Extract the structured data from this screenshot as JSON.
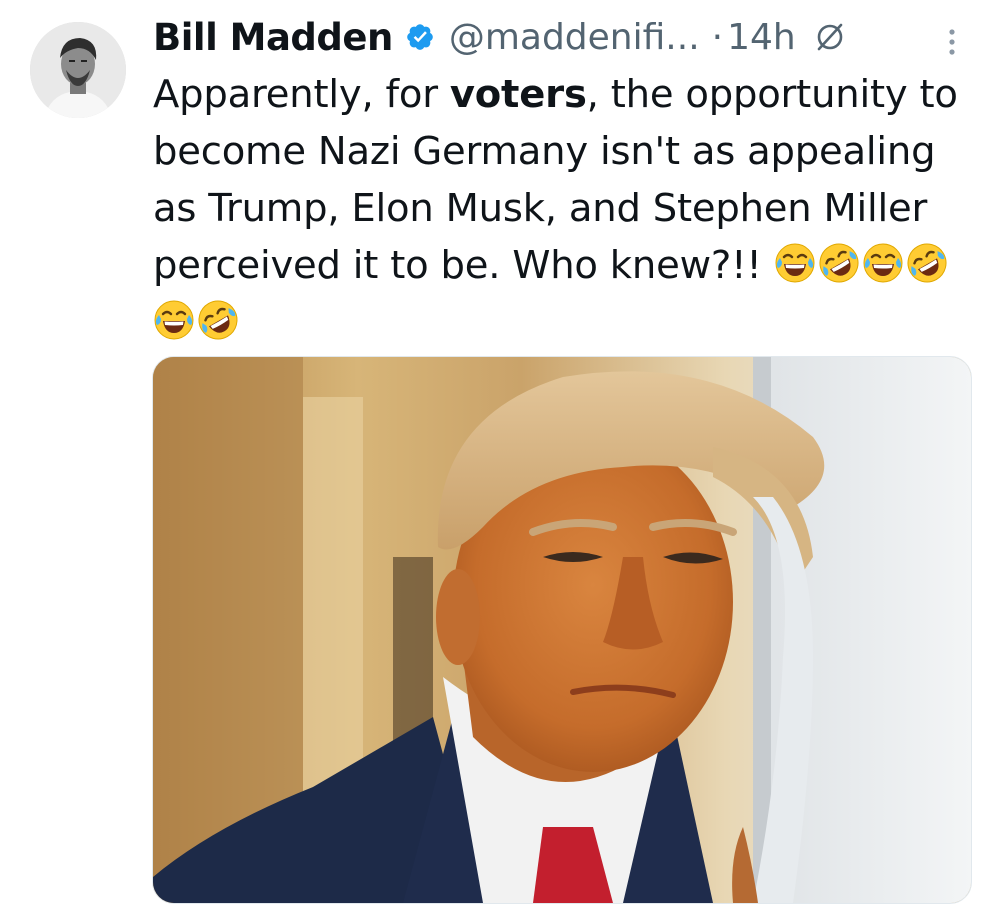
{
  "tweet": {
    "author": {
      "display_name": "Bill Madden",
      "handle": "@maddenifi...",
      "verified": true
    },
    "separator": "·",
    "timestamp": "14h",
    "text": {
      "line1_before": "Apparently, for ",
      "line1_bold": "voters",
      "line1_after": ", the opportunity to",
      "line2": "become Nazi Germany isn't as appealing",
      "line3": "as Trump, Elon Musk, and Stephen Miller",
      "line4": "perceived it to be. Who knew?!!"
    },
    "emojis_line4": [
      "joy-emoji",
      "rofl-emoji",
      "joy-emoji",
      "rofl-emoji"
    ],
    "emojis_line5": [
      "joy-emoji",
      "rofl-emoji"
    ],
    "media": {
      "type": "photo"
    }
  },
  "colors": {
    "text_primary": "#0f1419",
    "text_secondary": "#536471",
    "verified_blue": "#1d9bf0"
  }
}
